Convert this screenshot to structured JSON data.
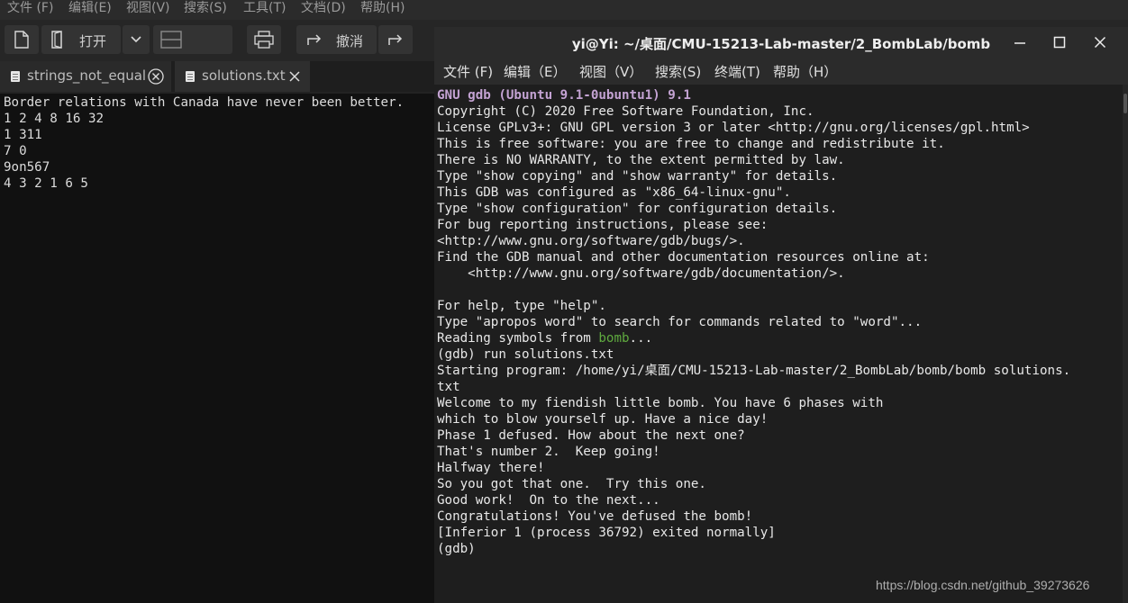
{
  "editor": {
    "menu": [
      "文件 (F)",
      "编辑(E)",
      "视图(V)",
      "搜索(S)",
      "工具(T)",
      "文档(D)",
      "帮助(H)"
    ],
    "toolbar": {
      "open_label": "打开",
      "undo_label": "撤消"
    },
    "tabs": [
      {
        "label": "strings_not_equal"
      },
      {
        "label": "solutions.txt"
      }
    ],
    "lines": [
      "Border relations with Canada have never been better.",
      "1 2 4 8 16 32",
      "1 311",
      "7 0",
      "9on567",
      "4 3 2 1 6 5"
    ]
  },
  "terminal": {
    "title": "yi@Yi: ~/桌面/CMU-15213-Lab-master/2_BombLab/bomb",
    "menu": [
      "文件 (F)",
      "编辑（E）",
      "视图（V）",
      "搜索(S)",
      "终端(T)",
      "帮助（H）"
    ],
    "header_line": "GNU gdb (Ubuntu 9.1-0ubuntu1) 9.1",
    "lines": [
      "Copyright (C) 2020 Free Software Foundation, Inc.",
      "License GPLv3+: GNU GPL version 3 or later <http://gnu.org/licenses/gpl.html>",
      "This is free software: you are free to change and redistribute it.",
      "There is NO WARRANTY, to the extent permitted by law.",
      "Type \"show copying\" and \"show warranty\" for details.",
      "This GDB was configured as \"x86_64-linux-gnu\".",
      "Type \"show configuration\" for configuration details.",
      "For bug reporting instructions, please see:",
      "<http://www.gnu.org/software/gdb/bugs/>.",
      "Find the GDB manual and other documentation resources online at:",
      "    <http://www.gnu.org/software/gdb/documentation/>.",
      "",
      "For help, type \"help\".",
      "Type \"apropos word\" to search for commands related to \"word\"..."
    ],
    "reading_prefix": "Reading symbols from ",
    "reading_file": "bomb",
    "reading_suffix": "...",
    "lines2": [
      "(gdb) run solutions.txt",
      "Starting program: /home/yi/桌面/CMU-15213-Lab-master/2_BombLab/bomb/bomb solutions.",
      "txt",
      "Welcome to my fiendish little bomb. You have 6 phases with",
      "which to blow yourself up. Have a nice day!",
      "Phase 1 defused. How about the next one?",
      "That's number 2.  Keep going!",
      "Halfway there!",
      "So you got that one.  Try this one.",
      "Good work!  On to the next...",
      "Congratulations! You've defused the bomb!",
      "[Inferior 1 (process 36792) exited normally]",
      "(gdb)"
    ]
  },
  "watermark": "https://blog.csdn.net/github_39273626",
  "colors": {
    "gdb_header": "#c4a3d3",
    "file_highlight": "#5faa3f"
  }
}
